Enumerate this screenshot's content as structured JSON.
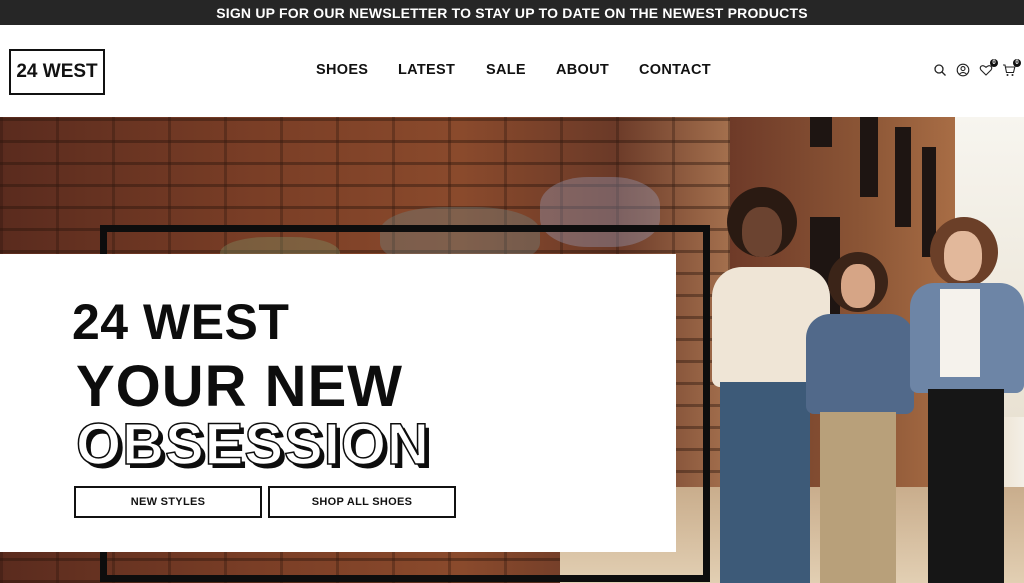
{
  "announcement": {
    "text": "SIGN UP FOR OUR NEWSLETTER TO STAY UP TO DATE ON THE NEWEST PRODUCTS"
  },
  "header": {
    "logo": "24 WEST",
    "nav": [
      "SHOES",
      "LATEST",
      "SALE",
      "ABOUT",
      "CONTACT"
    ],
    "icons": {
      "search": "search-icon",
      "account": "user-icon",
      "wishlist": {
        "icon": "heart-icon",
        "count": "0"
      },
      "cart": {
        "icon": "cart-icon",
        "count": "0"
      }
    }
  },
  "hero": {
    "brand": "24 WEST",
    "headline_line1": "YOUR NEW",
    "headline_line2": "OBSESSION",
    "buttons": {
      "new_styles": "NEW STYLES",
      "shop_all": "SHOP ALL SHOES"
    }
  },
  "colors": {
    "dark": "#262626",
    "text": "#111111",
    "background": "#ffffff"
  }
}
